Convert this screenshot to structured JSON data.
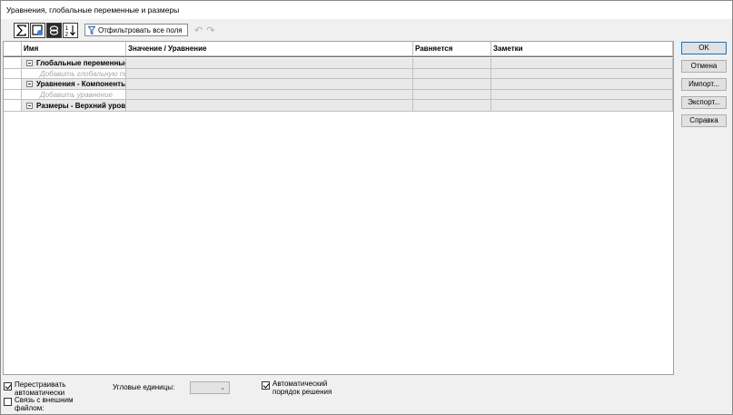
{
  "window": {
    "title": "Уравнения, глобальные переменные и размеры"
  },
  "toolbar": {
    "buttons": [
      "sum-icon",
      "view-icon",
      "layers-icon",
      "sort-icon"
    ],
    "filter_text": "Отфильтровать все поля",
    "undo_icon": "undo-icon",
    "redo_icon": "redo-icon"
  },
  "grid": {
    "columns": [
      "Имя",
      "Значение / Уравнение",
      "Равняется",
      "Заметки"
    ],
    "rows": [
      {
        "type": "group",
        "name": "Глобальные переменные"
      },
      {
        "type": "placeholder",
        "name": "Добавить глобальную пере"
      },
      {
        "type": "group",
        "name": "Уравнения - Компоненты"
      },
      {
        "type": "placeholder",
        "name": "Добавить уравнение"
      },
      {
        "type": "group",
        "name": "Размеры - Верхний уровен"
      }
    ]
  },
  "buttons": {
    "ok": "OK",
    "cancel": "Отмена",
    "import": "Импорт...",
    "export": "Экспорт...",
    "help": "Справка"
  },
  "bottom": {
    "auto_rebuild": {
      "label": "Перестраивать автоматически",
      "checked": true
    },
    "link_file": {
      "label": "Связь с внешним файлом:",
      "checked": false
    },
    "angle_units_label": "Угловые единицы:",
    "angle_units_value": "",
    "auto_solve": {
      "label": "Автоматический порядок решения",
      "checked": true
    }
  }
}
